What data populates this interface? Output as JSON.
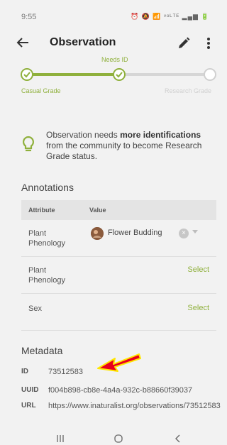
{
  "status_bar": {
    "time": "9:55",
    "icons_text": "⏰ 🔕 📶 ᵛᵒᴸᵀᴱ ▂▄▆ 🔋"
  },
  "app_bar": {
    "title": "Observation",
    "back_icon": "arrow-left-icon",
    "edit_icon": "pencil-icon",
    "more_icon": "more-vertical-icon"
  },
  "progress": {
    "labels": {
      "casual": "Casual Grade",
      "needs_id": "Needs ID",
      "research": "Research Grade"
    },
    "current_step": "Needs ID",
    "colors": {
      "active": "#8fb03c",
      "inactive": "#d6d6d6"
    }
  },
  "notice": {
    "icon": "lightbulb-icon",
    "text_before": "Observation needs ",
    "text_bold": "more identifications",
    "text_after": " from the community to become Research Grade status."
  },
  "annotations": {
    "title": "Annotations",
    "headers": {
      "attribute": "Attribute",
      "value": "Value"
    },
    "rows": [
      {
        "attribute": "Plant Phenology",
        "value": "Flower Budding",
        "action": ""
      },
      {
        "attribute": "Plant Phenology",
        "value": "",
        "action": "Select"
      },
      {
        "attribute": "Sex",
        "value": "",
        "action": "Select"
      }
    ]
  },
  "metadata": {
    "title": "Metadata",
    "id": {
      "key": "ID",
      "value": "73512583"
    },
    "uuid": {
      "key": "UUID",
      "value": "f004b898-cb8e-4a4a-932c-b88660f39037"
    },
    "url": {
      "key": "URL",
      "value": "https://www.inaturalist.org/observations/73512583"
    }
  },
  "nav_bar": {
    "recents": "recents-icon",
    "home": "home-icon",
    "back": "back-icon"
  },
  "colors": {
    "accent": "#8fb03c",
    "arrow_fill": "#e8001c",
    "arrow_outline": "#ffe600"
  }
}
